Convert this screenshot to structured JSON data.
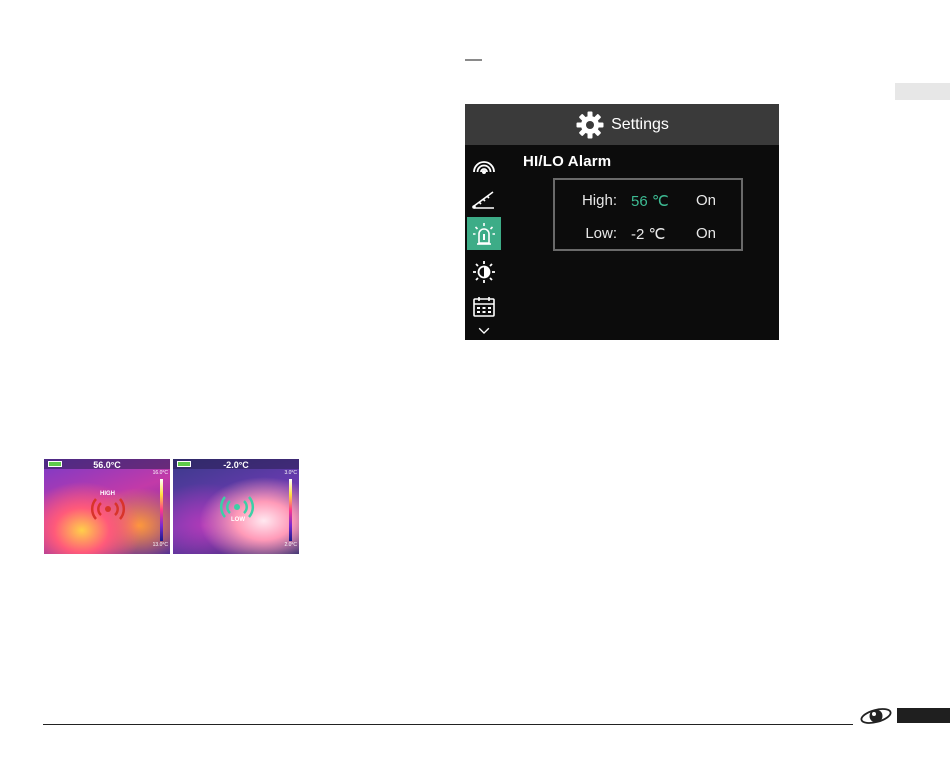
{
  "screen": {
    "title": "Settings",
    "section_heading": "HI/LO Alarm",
    "menu": [
      {
        "icon": "emissivity-icon",
        "active": false
      },
      {
        "icon": "distance-icon",
        "active": false
      },
      {
        "icon": "alarm-icon",
        "active": true
      },
      {
        "icon": "brightness-icon",
        "active": false
      },
      {
        "icon": "calendar-icon",
        "active": false
      },
      {
        "icon": "chevron-down-icon",
        "active": false
      }
    ],
    "alarm": {
      "high_label": "High:",
      "high_value": "56 ℃",
      "high_state": "On",
      "low_label": "Low:",
      "low_value": "-2 ℃",
      "low_state": "On"
    },
    "accent_color": "#3dac87"
  },
  "thermal_images": [
    {
      "temperature": "56.0°C",
      "alarm_text": "HIGH",
      "scale_max": "16.0°C",
      "scale_min": "13.0°C"
    },
    {
      "temperature": "-2.0°C",
      "alarm_text": "LOW",
      "scale_max": "3.0°C",
      "scale_min": "2.0°C"
    }
  ]
}
